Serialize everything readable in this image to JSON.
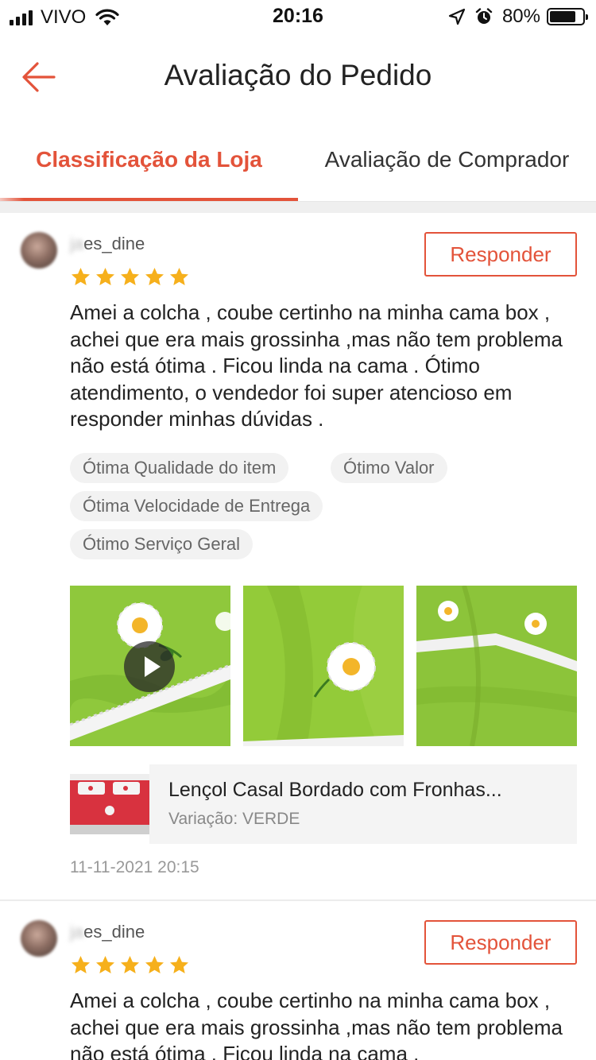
{
  "status_bar": {
    "carrier": "VIVO",
    "time": "20:16",
    "battery_percent": "80%",
    "battery_level": 0.8,
    "icons": [
      "signal-icon",
      "wifi-icon",
      "location-icon",
      "alarm-icon",
      "battery-icon"
    ]
  },
  "header": {
    "title": "Avaliação do Pedido",
    "back_icon": "arrow-left-icon"
  },
  "tabs": [
    {
      "label": "Classificação da Loja",
      "active": true
    },
    {
      "label": "Avaliação de Comprador",
      "active": false
    }
  ],
  "colors": {
    "accent": "#e3533a",
    "star": "#f6b01c",
    "tag_bg": "#f2f2f2",
    "photo_green": "#8dc63f"
  },
  "reviews": [
    {
      "username_hidden": "ja",
      "username": "es_dine",
      "reply_label": "Responder",
      "rating": 5,
      "text": "Amei a colcha , coube certinho na minha cama box , achei que era mais grossinha ,mas não tem problema não está ótima . Ficou linda na cama . Ótimo atendimento, o vendedor foi super atencioso em responder minhas dúvidas .",
      "tags": [
        "Ótima Qualidade do item",
        "Ótimo Valor",
        "Ótima Velocidade de Entrega",
        "Ótimo Serviço Geral"
      ],
      "photos": [
        {
          "kind": "video",
          "icon": "play-icon"
        },
        {
          "kind": "image"
        },
        {
          "kind": "image"
        }
      ],
      "product": {
        "name": "Lençol Casal Bordado com Fronhas...",
        "variation": "Variação: VERDE"
      },
      "date": "11-11-2021 20:15"
    },
    {
      "username_hidden": "ja",
      "username": "es_dine",
      "reply_label": "Responder",
      "rating": 5,
      "text": "Amei a colcha , coube certinho na minha cama box , achei que era mais grossinha ,mas não tem problema não está ótima . Ficou linda na cama ."
    }
  ]
}
